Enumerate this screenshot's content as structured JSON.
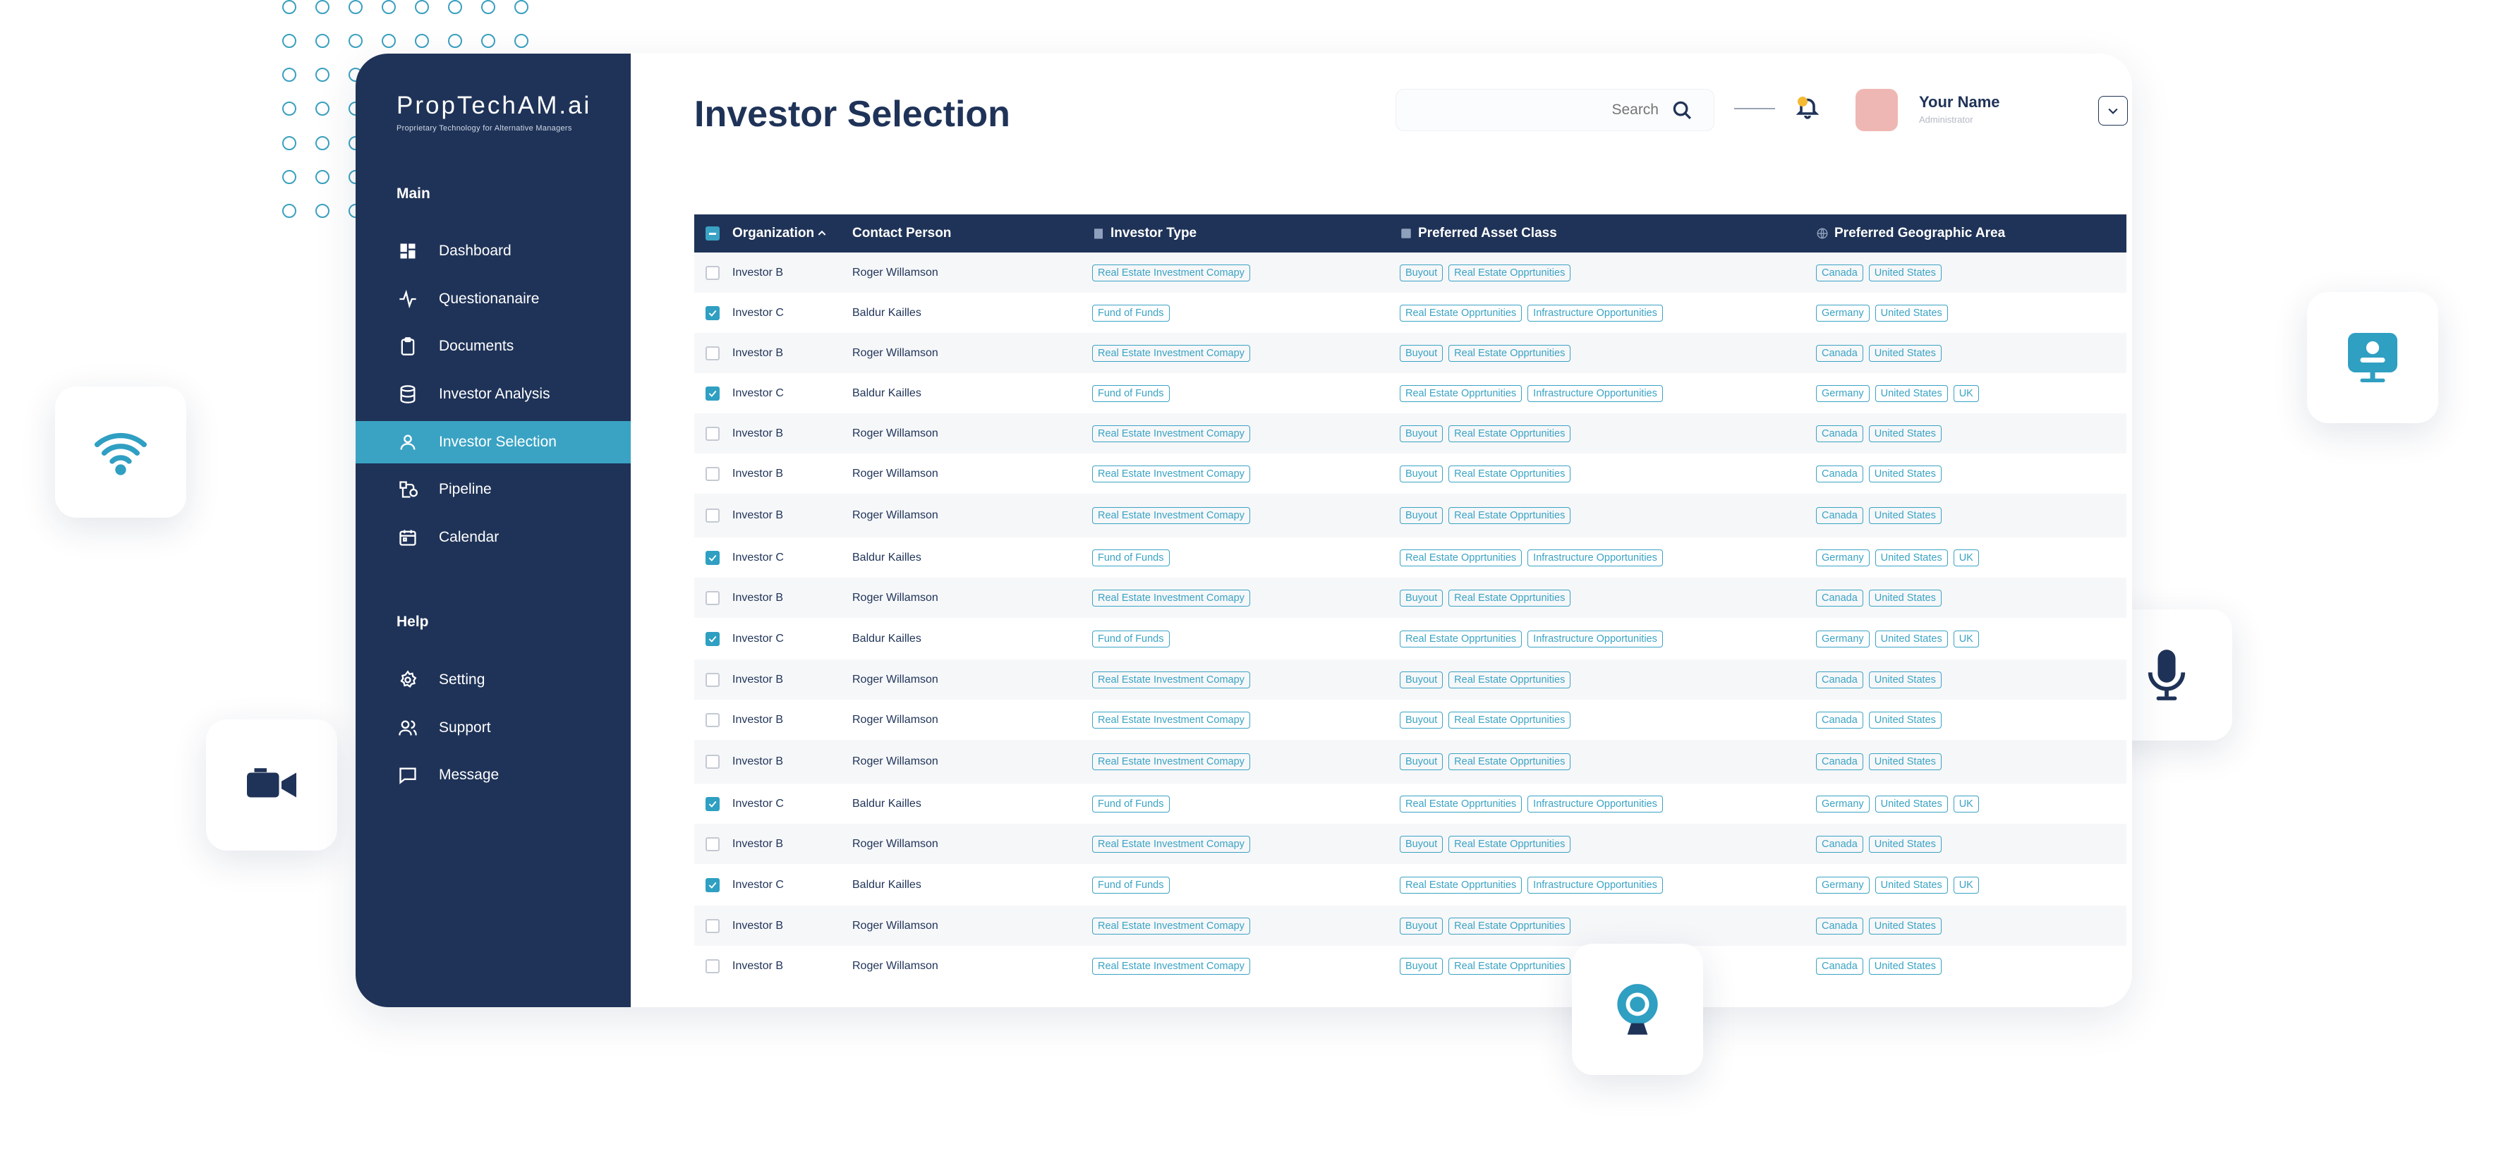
{
  "brand": {
    "name": "PropTechAM.ai",
    "tagline": "Proprietary Technology for Alternative Managers"
  },
  "sidebar": {
    "main_label": "Main",
    "main_items": [
      {
        "label": "Dashboard",
        "icon": "dashboard-icon"
      },
      {
        "label": "Questionanaire",
        "icon": "activity-icon"
      },
      {
        "label": "Documents",
        "icon": "clipboard-icon"
      },
      {
        "label": "Investor Analysis",
        "icon": "database-icon"
      },
      {
        "label": "Investor Selection",
        "icon": "user-icon",
        "active": true
      },
      {
        "label": "Pipeline",
        "icon": "pipeline-icon"
      },
      {
        "label": "Calendar",
        "icon": "calendar-icon"
      }
    ],
    "help_label": "Help",
    "help_items": [
      {
        "label": "Setting",
        "icon": "gear-icon"
      },
      {
        "label": "Support",
        "icon": "users-icon"
      },
      {
        "label": "Message",
        "icon": "message-icon"
      }
    ]
  },
  "header": {
    "title": "Investor Selection",
    "search_placeholder": "Search",
    "user_name": "Your Name",
    "user_role": "Administrator"
  },
  "table": {
    "columns": [
      "Organization",
      "Contact Person",
      "Investor Type",
      "Preferred Asset Class",
      "Preferred Geographic Area"
    ],
    "rows": [
      {
        "checked": false,
        "org": "Investor B",
        "contact": "Roger Willamson",
        "type": [
          "Real Estate Investment Comapy"
        ],
        "asset": [
          "Buyout",
          "Real Estate Opprtunities"
        ],
        "geo": [
          "Canada",
          "United States"
        ]
      },
      {
        "checked": true,
        "org": "Investor C",
        "contact": "Baldur Kailles",
        "type": [
          "Fund of Funds"
        ],
        "asset": [
          "Real Estate Opprtunities",
          "Infrastructure Opportunities"
        ],
        "geo": [
          "Germany",
          "United States"
        ]
      },
      {
        "checked": false,
        "org": "Investor B",
        "contact": "Roger Willamson",
        "type": [
          "Real Estate Investment Comapy"
        ],
        "asset": [
          "Buyout",
          "Real Estate Opprtunities"
        ],
        "geo": [
          "Canada",
          "United States"
        ]
      },
      {
        "checked": true,
        "org": "Investor C",
        "contact": "Baldur Kailles",
        "type": [
          "Fund of Funds"
        ],
        "asset": [
          "Real Estate Opprtunities",
          "Infrastructure Opportunities"
        ],
        "geo": [
          "Germany",
          "United States",
          "UK"
        ]
      },
      {
        "checked": false,
        "org": "Investor B",
        "contact": "Roger Willamson",
        "type": [
          "Real Estate Investment Comapy"
        ],
        "asset": [
          "Buyout",
          "Real Estate Opprtunities"
        ],
        "geo": [
          "Canada",
          "United States"
        ]
      },
      {
        "checked": false,
        "org": "Investor B",
        "contact": "Roger Willamson",
        "type": [
          "Real Estate Investment Comapy"
        ],
        "asset": [
          "Buyout",
          "Real Estate Opprtunities"
        ],
        "geo": [
          "Canada",
          "United States"
        ]
      },
      {
        "checked": false,
        "org": "Investor B",
        "contact": "Roger Willamson",
        "type": [
          "Real Estate Investment Comapy"
        ],
        "asset": [
          "Buyout",
          "Real Estate Opprtunities"
        ],
        "geo": [
          "Canada",
          "United States"
        ]
      },
      {
        "checked": true,
        "org": "Investor C",
        "contact": "Baldur Kailles",
        "type": [
          "Fund of Funds"
        ],
        "asset": [
          "Real Estate Opprtunities",
          "Infrastructure Opportunities"
        ],
        "geo": [
          "Germany",
          "United States",
          "UK"
        ]
      },
      {
        "checked": false,
        "org": "Investor B",
        "contact": "Roger Willamson",
        "type": [
          "Real Estate Investment Comapy"
        ],
        "asset": [
          "Buyout",
          "Real Estate Opprtunities"
        ],
        "geo": [
          "Canada",
          "United States"
        ]
      },
      {
        "checked": true,
        "org": "Investor C",
        "contact": "Baldur Kailles",
        "type": [
          "Fund of Funds"
        ],
        "asset": [
          "Real Estate Opprtunities",
          "Infrastructure Opportunities"
        ],
        "geo": [
          "Germany",
          "United States",
          "UK"
        ]
      },
      {
        "checked": false,
        "org": "Investor B",
        "contact": "Roger Willamson",
        "type": [
          "Real Estate Investment Comapy"
        ],
        "asset": [
          "Buyout",
          "Real Estate Opprtunities"
        ],
        "geo": [
          "Canada",
          "United States"
        ]
      },
      {
        "checked": false,
        "org": "Investor B",
        "contact": "Roger Willamson",
        "type": [
          "Real Estate Investment Comapy"
        ],
        "asset": [
          "Buyout",
          "Real Estate Opprtunities"
        ],
        "geo": [
          "Canada",
          "United States"
        ]
      },
      {
        "checked": false,
        "org": "Investor B",
        "contact": "Roger Willamson",
        "type": [
          "Real Estate Investment Comapy"
        ],
        "asset": [
          "Buyout",
          "Real Estate Opprtunities"
        ],
        "geo": [
          "Canada",
          "United States"
        ]
      },
      {
        "checked": true,
        "org": "Investor C",
        "contact": "Baldur Kailles",
        "type": [
          "Fund of Funds"
        ],
        "asset": [
          "Real Estate Opprtunities",
          "Infrastructure Opportunities"
        ],
        "geo": [
          "Germany",
          "United States",
          "UK"
        ]
      },
      {
        "checked": false,
        "org": "Investor B",
        "contact": "Roger Willamson",
        "type": [
          "Real Estate Investment Comapy"
        ],
        "asset": [
          "Buyout",
          "Real Estate Opprtunities"
        ],
        "geo": [
          "Canada",
          "United States"
        ]
      },
      {
        "checked": true,
        "org": "Investor C",
        "contact": "Baldur Kailles",
        "type": [
          "Fund of Funds"
        ],
        "asset": [
          "Real Estate Opprtunities",
          "Infrastructure Opportunities"
        ],
        "geo": [
          "Germany",
          "United States",
          "UK"
        ]
      },
      {
        "checked": false,
        "org": "Investor B",
        "contact": "Roger Willamson",
        "type": [
          "Real Estate Investment Comapy"
        ],
        "asset": [
          "Buyout",
          "Real Estate Opprtunities"
        ],
        "geo": [
          "Canada",
          "United States"
        ]
      },
      {
        "checked": false,
        "org": "Investor B",
        "contact": "Roger Willamson",
        "type": [
          "Real Estate Investment Comapy"
        ],
        "asset": [
          "Buyout",
          "Real Estate Opprtunities"
        ],
        "geo": [
          "Canada",
          "United States"
        ]
      }
    ]
  },
  "floating_cards": [
    {
      "icon": "wifi-icon"
    },
    {
      "icon": "video-camera-icon"
    },
    {
      "icon": "presenter-icon"
    },
    {
      "icon": "microphone-icon"
    },
    {
      "icon": "webcam-icon"
    }
  ],
  "colors": {
    "navy": "#1f3358",
    "accent": "#3aa3c4",
    "bell_dot": "#f5b933",
    "avatar": "#efb7b3"
  }
}
